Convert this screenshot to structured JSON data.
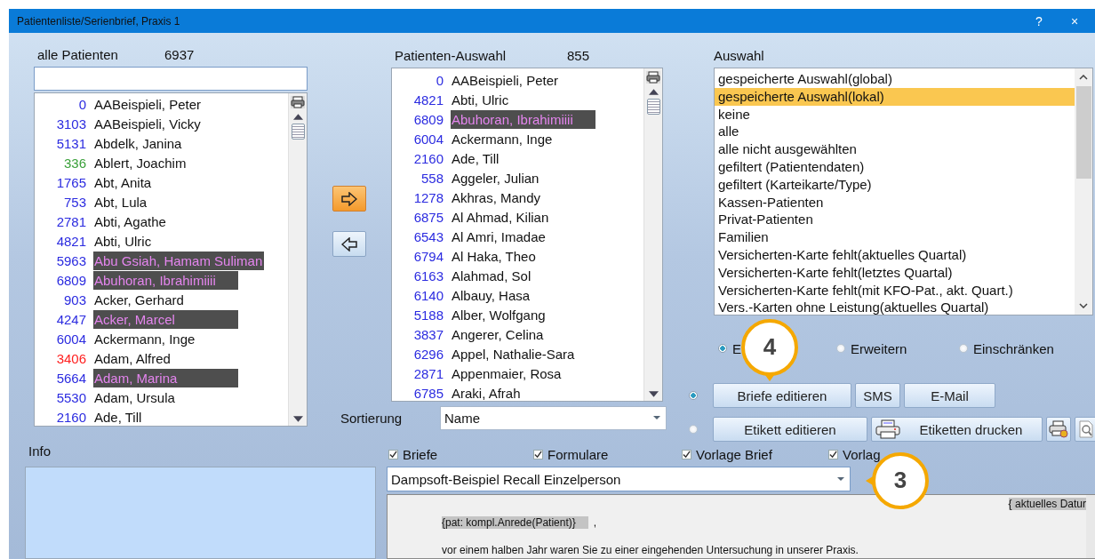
{
  "window": {
    "title": "Patientenliste/Serienbrief, Praxis 1",
    "help": "?",
    "close": "×"
  },
  "all_patients": {
    "label": "alle Patienten",
    "count": "6937",
    "rows": [
      {
        "number": "0",
        "name": "AABeispieli, Peter",
        "color": "#2b2be0",
        "highlighted": false
      },
      {
        "number": "3103",
        "name": "AABeispieli, Vicky",
        "color": "#2b2be0",
        "highlighted": false
      },
      {
        "number": "5131",
        "name": "Abdelk, Janina",
        "color": "#2b2be0",
        "highlighted": false
      },
      {
        "number": "336",
        "name": "Ablert, Joachim",
        "color": "#3aa03a",
        "highlighted": false
      },
      {
        "number": "1765",
        "name": "Abt, Anita",
        "color": "#2b2be0",
        "highlighted": false
      },
      {
        "number": "753",
        "name": "Abt, Lula",
        "color": "#2b2be0",
        "highlighted": false
      },
      {
        "number": "2781",
        "name": "Abti, Agathe",
        "color": "#2b2be0",
        "highlighted": false
      },
      {
        "number": "4821",
        "name": "Abti, Ulric",
        "color": "#2b2be0",
        "highlighted": false
      },
      {
        "number": "5963",
        "name": "Abu Gsiah, Hamam Suliman",
        "color": "#2b2be0",
        "highlighted": true
      },
      {
        "number": "6809",
        "name": "Abuhoran, Ibrahimiiii",
        "color": "#2b2be0",
        "highlighted": true
      },
      {
        "number": "903",
        "name": "Acker, Gerhard",
        "color": "#2b2be0",
        "highlighted": false
      },
      {
        "number": "4247",
        "name": "Acker, Marcel",
        "color": "#2b2be0",
        "highlighted": true
      },
      {
        "number": "6004",
        "name": "Ackermann, Inge",
        "color": "#2b2be0",
        "highlighted": false
      },
      {
        "number": "3406",
        "name": "Adam, Alfred",
        "color": "#ff2020",
        "highlighted": false
      },
      {
        "number": "5664",
        "name": "Adam, Marina",
        "color": "#2b2be0",
        "highlighted": true
      },
      {
        "number": "5530",
        "name": "Adam, Ursula",
        "color": "#2b2be0",
        "highlighted": false
      },
      {
        "number": "2160",
        "name": "Ade, Till",
        "color": "#2b2be0",
        "highlighted": false
      }
    ]
  },
  "transfer_buttons": [
    {
      "kind": "add",
      "active": true
    },
    {
      "kind": "remove",
      "active": false
    }
  ],
  "selection": {
    "label": "Patienten-Auswahl",
    "count": "855",
    "rows": [
      {
        "number": "0",
        "name": "AABeispieli, Peter",
        "color": "#2b2be0",
        "highlighted": false
      },
      {
        "number": "4821",
        "name": "Abti, Ulric",
        "color": "#2b2be0",
        "highlighted": false
      },
      {
        "number": "6809",
        "name": "Abuhoran, Ibrahimiiii",
        "color": "#2b2be0",
        "highlighted": true
      },
      {
        "number": "6004",
        "name": "Ackermann, Inge",
        "color": "#2b2be0",
        "highlighted": false
      },
      {
        "number": "2160",
        "name": "Ade, Till",
        "color": "#2b2be0",
        "highlighted": false
      },
      {
        "number": "558",
        "name": "Aggeler, Julian",
        "color": "#2b2be0",
        "highlighted": false
      },
      {
        "number": "1278",
        "name": "Akhras, Mandy",
        "color": "#2b2be0",
        "highlighted": false
      },
      {
        "number": "6875",
        "name": "Al Ahmad, Kilian",
        "color": "#2b2be0",
        "highlighted": false
      },
      {
        "number": "6543",
        "name": "Al Amri, Imadae",
        "color": "#2b2be0",
        "highlighted": false
      },
      {
        "number": "6794",
        "name": "Al Haka, Theo",
        "color": "#2b2be0",
        "highlighted": false
      },
      {
        "number": "6163",
        "name": "Alahmad, Sol",
        "color": "#2b2be0",
        "highlighted": false
      },
      {
        "number": "6140",
        "name": "Albauy, Hasa",
        "color": "#2b2be0",
        "highlighted": false
      },
      {
        "number": "5188",
        "name": "Alber, Wolfgang",
        "color": "#2b2be0",
        "highlighted": false
      },
      {
        "number": "3837",
        "name": "Angerer, Celina",
        "color": "#2b2be0",
        "highlighted": false
      },
      {
        "number": "6296",
        "name": "Appel, Nathalie-Sara",
        "color": "#2b2be0",
        "highlighted": false
      },
      {
        "number": "2871",
        "name": "Appenmaier, Rosa",
        "color": "#2b2be0",
        "highlighted": false
      },
      {
        "number": "6785",
        "name": "Araki, Afrah",
        "color": "#2b2be0",
        "highlighted": false
      }
    ]
  },
  "sorting": {
    "label": "Sortierung",
    "value": "Name"
  },
  "filter": {
    "label": "Auswahl",
    "items": [
      {
        "label": "gespeicherte Auswahl(global)",
        "selected": false
      },
      {
        "label": "gespeicherte Auswahl(lokal)",
        "selected": true
      },
      {
        "label": "keine",
        "selected": false
      },
      {
        "label": "alle",
        "selected": false
      },
      {
        "label": "alle nicht ausgewählten",
        "selected": false
      },
      {
        "label": "gefiltert (Patientendaten)",
        "selected": false
      },
      {
        "label": "gefiltert (Karteikarte/Type)",
        "selected": false
      },
      {
        "label": "Kassen-Patienten",
        "selected": false
      },
      {
        "label": "Privat-Patienten",
        "selected": false
      },
      {
        "label": "Familien",
        "selected": false
      },
      {
        "label": "Versicherten-Karte fehlt(aktuelles Quartal)",
        "selected": false
      },
      {
        "label": "Versicherten-Karte fehlt(letztes Quartal)",
        "selected": false
      },
      {
        "label": "Versicherten-Karte fehlt(mit KFO-Pat., akt. Quart.)",
        "selected": false
      },
      {
        "label": "Vers.-Karten ohne Leistung(aktuelles Quartal)",
        "selected": false
      }
    ]
  },
  "modes": [
    {
      "label": "E",
      "selected": true
    },
    {
      "label": "Erweitern",
      "selected": false
    },
    {
      "label": "Einschränken",
      "selected": false
    }
  ],
  "output_rows": [
    {
      "selected": true,
      "buttons": [
        {
          "kind": "text",
          "label": "Briefe editieren"
        },
        {
          "kind": "text",
          "label": "SMS"
        },
        {
          "kind": "text",
          "label": "E-Mail"
        }
      ]
    },
    {
      "selected": false,
      "buttons": [
        {
          "kind": "text",
          "label": "Etikett editieren"
        },
        {
          "kind": "print",
          "label": "Etiketten drucken"
        },
        {
          "kind": "setup"
        },
        {
          "kind": "preview"
        }
      ]
    }
  ],
  "info": {
    "label": "Info"
  },
  "doc_types": [
    {
      "label": "Briefe",
      "checked": true
    },
    {
      "label": "Formulare",
      "checked": true
    },
    {
      "label": "Vorlage Brief",
      "checked": true
    },
    {
      "label": "Vorlag",
      "checked": true
    }
  ],
  "template": {
    "value": "Dampsoft-Beispiel Recall Einzelperson"
  },
  "document": {
    "date_field": "{ aktuelles Datur",
    "salutation_field": "{pat: kompl.Anrede(Patient)}",
    "salutation_end": ",",
    "body": "vor einem halben Jahr waren Sie zu einer eingehenden Untersuchung in unserer Praxis."
  },
  "callouts": [
    {
      "number": "4"
    },
    {
      "number": "3"
    }
  ]
}
